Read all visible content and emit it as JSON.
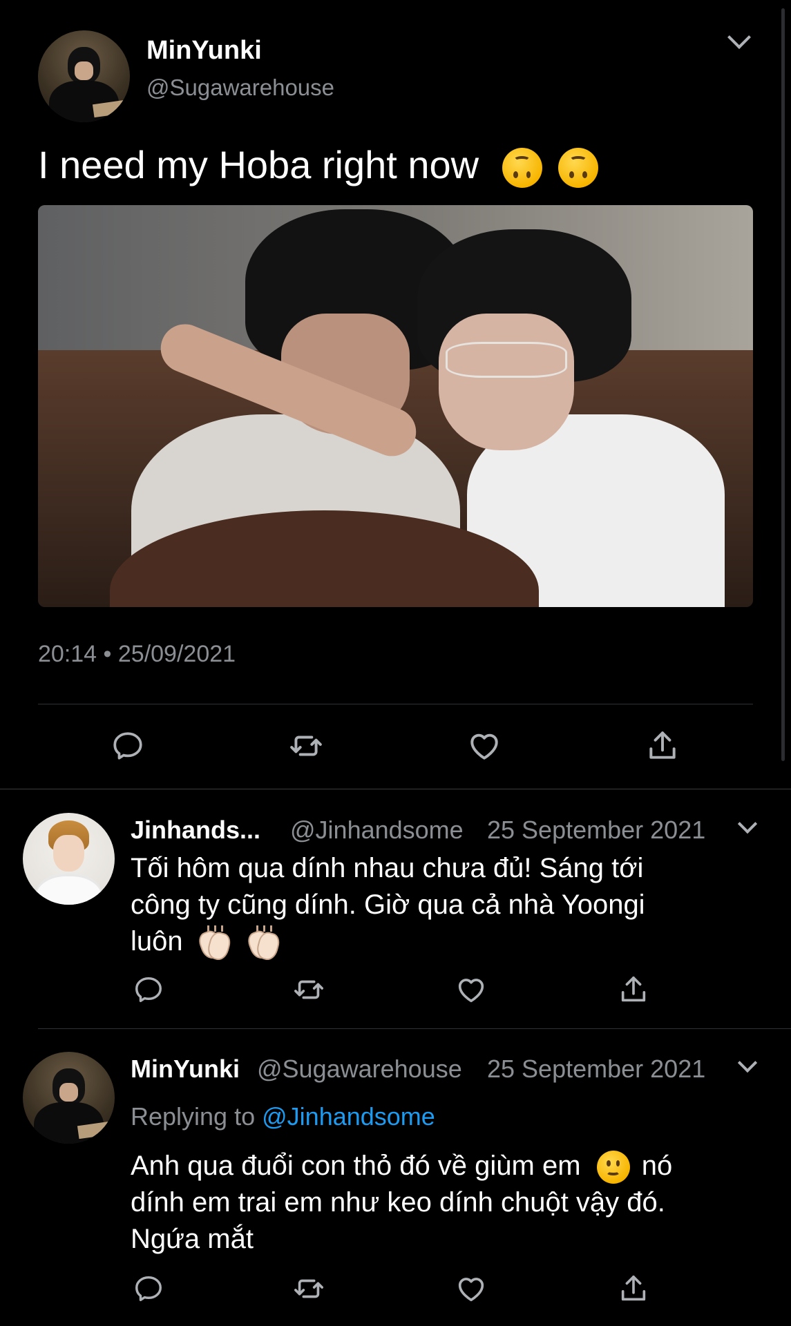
{
  "main_tweet": {
    "display_name": "MinYunki",
    "handle": "@Sugawarehouse",
    "text": "I need my Hoba right now",
    "emoji": [
      "upside-down-face",
      "upside-down-face"
    ],
    "timestamp": "20:14 • 25/09/2021"
  },
  "replies": [
    {
      "display_name": "Jinhands...",
      "handle": "@Jinhandsome",
      "date": "25 September 2021",
      "text_line1": "Tối hôm qua dính nhau chưa đủ! Sáng tới",
      "text_line2": "công ty cũng dính. Giờ qua cả nhà Yoongi",
      "text_line3": "luôn",
      "emoji": [
        "clapping-hands",
        "clapping-hands"
      ]
    },
    {
      "display_name": "MinYunki",
      "handle": "@Sugawarehouse",
      "date": "25 September 2021",
      "replying_prefix": "Replying to",
      "replying_handle": "@Jinhandsome",
      "text_line1a": "Anh qua đuổi con thỏ đó về giùm em",
      "text_line1b": "nó",
      "text_line2": "dính em trai em như keo dính chuột vậy đó.",
      "text_line3": "Ngứa mắt",
      "emoji": [
        "slightly-smiling-face"
      ]
    }
  ],
  "icons": [
    "chevron-down-icon",
    "reply-icon",
    "retweet-icon",
    "like-icon",
    "share-icon"
  ],
  "colors": {
    "background": "#000000",
    "text": "#ffffff",
    "secondary": "#8b8f94",
    "link": "#1d9bf0",
    "divider": "#2f3336"
  }
}
